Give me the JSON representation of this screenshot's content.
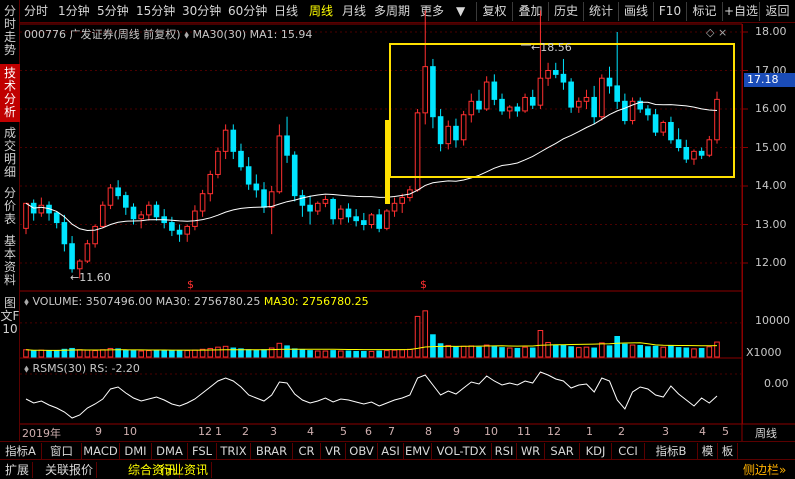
{
  "toolbar": {
    "periods": [
      "分时",
      "1分钟",
      "5分钟",
      "15分钟",
      "30分钟",
      "60分钟",
      "日线",
      "周线",
      "月线",
      "多周期",
      "更多"
    ],
    "active_period": "周线",
    "buttons": [
      "复权",
      "叠加",
      "历史",
      "统计",
      "画线",
      "F10",
      "标记",
      "+自选",
      "返回"
    ]
  },
  "left_tabs": [
    "分时走势",
    "技术分析",
    "成交明细",
    "分价表",
    "基本资料",
    "图文F10"
  ],
  "active_left_tab": "技术分析",
  "main_chart": {
    "stock_title": "000776 广发证券(周线 前复权)",
    "ma_label": "MA30(30)",
    "ma_value": "MA1: 15.94",
    "current_price": "17.18",
    "high_marker": "18.56",
    "low_marker": "11.60",
    "y_ticks": [
      "18.00",
      "17.00",
      "16.00",
      "15.00",
      "14.00",
      "13.00",
      "12.00"
    ],
    "dividend_marks": [
      "$",
      "$"
    ]
  },
  "volume_pane": {
    "title": "VOLUME: 3507496.00",
    "ma_label": "MA30: 2756780.25",
    "ma_label_2": "MA30: 2756780.25",
    "y_tick": "10000",
    "unit": "X1000"
  },
  "rsms_pane": {
    "title": "RSMS(30)",
    "value": "RS: -2.20",
    "y_tick": "0.00"
  },
  "date_axis": {
    "labels": [
      "2019年",
      "9",
      "10",
      "12",
      "1",
      "2",
      "3",
      "4",
      "5",
      "6",
      "7",
      "8",
      "9",
      "10",
      "11",
      "12",
      "1",
      "2",
      "3",
      "4",
      "5"
    ],
    "right_label": "周线"
  },
  "indicator_tabs": [
    "指标A",
    "窗口",
    "MACD",
    "DMI",
    "DMA",
    "FSL",
    "TRIX",
    "BRAR",
    "CR",
    "VR",
    "OBV",
    "ASI",
    "EMV",
    "VOL-TDX",
    "RSI",
    "WR",
    "SAR",
    "KDJ",
    "CCI",
    "指标B",
    "模",
    "板"
  ],
  "info_bar": {
    "items": [
      "扩展",
      "关联报价",
      "综合资讯",
      "行业资讯"
    ],
    "right": "侧边栏"
  },
  "colors": {
    "up": "#ff3030",
    "down": "#00e5ff",
    "ma_line": "#ffffff",
    "highlight_box": "#ffe000",
    "frame": "#8b0000",
    "accent_yellow": "#ffff00"
  },
  "candles": [
    [
      12.9,
      13.55,
      12.75,
      13.55
    ],
    [
      13.55,
      13.65,
      13.1,
      13.3
    ],
    [
      13.3,
      13.7,
      13.2,
      13.5
    ],
    [
      13.5,
      13.6,
      13.1,
      13.3
    ],
    [
      13.3,
      13.35,
      12.9,
      13.05
    ],
    [
      13.05,
      13.25,
      12.3,
      12.5
    ],
    [
      12.5,
      12.7,
      11.75,
      11.85
    ],
    [
      11.85,
      12.1,
      11.6,
      12.05
    ],
    [
      12.05,
      12.6,
      12.0,
      12.5
    ],
    [
      12.5,
      13.0,
      12.4,
      12.95
    ],
    [
      12.95,
      13.6,
      12.9,
      13.5
    ],
    [
      13.5,
      14.05,
      13.4,
      13.95
    ],
    [
      13.95,
      14.15,
      13.65,
      13.75
    ],
    [
      13.75,
      13.85,
      13.25,
      13.45
    ],
    [
      13.45,
      13.55,
      13.0,
      13.15
    ],
    [
      13.15,
      13.35,
      12.9,
      13.25
    ],
    [
      13.25,
      13.6,
      13.1,
      13.5
    ],
    [
      13.5,
      13.6,
      13.1,
      13.2
    ],
    [
      13.2,
      13.4,
      12.9,
      13.05
    ],
    [
      13.05,
      13.2,
      12.7,
      12.85
    ],
    [
      12.85,
      13.0,
      12.55,
      12.75
    ],
    [
      12.75,
      13.0,
      12.55,
      12.95
    ],
    [
      12.95,
      13.5,
      12.85,
      13.35
    ],
    [
      13.35,
      13.9,
      13.2,
      13.8
    ],
    [
      13.8,
      14.4,
      13.6,
      14.3
    ],
    [
      14.3,
      15.0,
      14.2,
      14.9
    ],
    [
      14.9,
      15.6,
      14.7,
      15.45
    ],
    [
      15.45,
      15.6,
      14.7,
      14.9
    ],
    [
      14.9,
      15.1,
      14.4,
      14.5
    ],
    [
      14.5,
      14.75,
      13.9,
      14.05
    ],
    [
      14.05,
      14.3,
      13.7,
      13.9
    ],
    [
      13.9,
      14.1,
      13.3,
      13.45
    ],
    [
      13.45,
      14.0,
      12.75,
      13.85
    ],
    [
      13.85,
      15.6,
      13.8,
      15.3
    ],
    [
      15.3,
      15.8,
      14.6,
      14.8
    ],
    [
      14.8,
      14.9,
      13.6,
      13.75
    ],
    [
      13.75,
      13.9,
      13.2,
      13.5
    ],
    [
      13.5,
      13.75,
      13.0,
      13.35
    ],
    [
      13.35,
      13.6,
      13.25,
      13.55
    ],
    [
      13.55,
      13.75,
      13.45,
      13.65
    ],
    [
      13.65,
      13.7,
      13.0,
      13.15
    ],
    [
      13.15,
      13.5,
      13.0,
      13.4
    ],
    [
      13.4,
      13.55,
      13.05,
      13.2
    ],
    [
      13.2,
      13.4,
      12.95,
      13.1
    ],
    [
      13.1,
      13.3,
      12.85,
      13.0
    ],
    [
      13.0,
      13.3,
      12.9,
      13.25
    ],
    [
      13.25,
      13.4,
      12.8,
      12.9
    ],
    [
      12.9,
      13.4,
      12.85,
      13.35
    ],
    [
      13.35,
      13.7,
      13.2,
      13.55
    ],
    [
      13.55,
      13.8,
      13.3,
      13.7
    ],
    [
      13.7,
      14.0,
      13.6,
      13.9
    ],
    [
      13.9,
      16.0,
      13.85,
      15.9
    ],
    [
      15.9,
      18.56,
      15.6,
      17.1
    ],
    [
      17.1,
      17.3,
      15.5,
      15.8
    ],
    [
      15.8,
      16.0,
      14.9,
      15.1
    ],
    [
      15.1,
      15.7,
      14.95,
      15.55
    ],
    [
      15.55,
      15.75,
      15.0,
      15.2
    ],
    [
      15.2,
      15.95,
      15.05,
      15.85
    ],
    [
      15.85,
      16.4,
      15.65,
      16.2
    ],
    [
      16.2,
      16.5,
      15.9,
      16.0
    ],
    [
      16.0,
      16.85,
      15.95,
      16.7
    ],
    [
      16.7,
      16.9,
      16.1,
      16.25
    ],
    [
      16.25,
      16.4,
      15.85,
      15.95
    ],
    [
      15.95,
      16.1,
      15.75,
      16.05
    ],
    [
      16.05,
      16.15,
      15.8,
      15.95
    ],
    [
      15.95,
      16.4,
      15.9,
      16.3
    ],
    [
      16.3,
      16.5,
      16.0,
      16.1
    ],
    [
      16.1,
      18.56,
      16.0,
      16.8
    ],
    [
      16.8,
      17.2,
      16.6,
      17.0
    ],
    [
      17.0,
      17.2,
      16.8,
      16.9
    ],
    [
      16.9,
      17.3,
      16.5,
      16.7
    ],
    [
      16.7,
      16.8,
      15.9,
      16.05
    ],
    [
      16.05,
      16.3,
      15.9,
      16.2
    ],
    [
      16.2,
      16.5,
      16.0,
      16.3
    ],
    [
      16.3,
      16.6,
      15.6,
      15.8
    ],
    [
      15.8,
      16.9,
      15.7,
      16.8
    ],
    [
      16.8,
      17.1,
      16.4,
      16.6
    ],
    [
      16.6,
      18.0,
      16.0,
      16.2
    ],
    [
      16.2,
      16.4,
      15.6,
      15.7
    ],
    [
      15.7,
      16.3,
      15.6,
      16.2
    ],
    [
      16.2,
      16.3,
      15.9,
      16.0
    ],
    [
      16.0,
      16.1,
      15.7,
      15.85
    ],
    [
      15.85,
      16.0,
      15.3,
      15.4
    ],
    [
      15.4,
      15.7,
      15.3,
      15.65
    ],
    [
      15.65,
      15.8,
      15.1,
      15.2
    ],
    [
      15.2,
      15.5,
      14.9,
      15.0
    ],
    [
      15.0,
      15.2,
      14.6,
      14.7
    ],
    [
      14.7,
      14.95,
      14.55,
      14.9
    ],
    [
      14.9,
      15.0,
      14.7,
      14.8
    ],
    [
      14.8,
      15.3,
      14.75,
      15.2
    ],
    [
      15.2,
      16.45,
      15.1,
      16.25
    ]
  ],
  "volumes": [
    1.7,
    1.5,
    1.6,
    1.4,
    1.5,
    1.8,
    2.0,
    1.7,
    1.6,
    1.5,
    1.7,
    2.0,
    1.9,
    1.6,
    1.5,
    1.4,
    1.5,
    1.6,
    1.5,
    1.4,
    1.4,
    1.5,
    1.6,
    1.8,
    2.0,
    2.3,
    2.5,
    2.1,
    1.9,
    1.7,
    1.6,
    1.7,
    2.1,
    3.2,
    2.6,
    1.9,
    1.7,
    1.5,
    1.4,
    1.4,
    1.5,
    1.4,
    1.4,
    1.3,
    1.3,
    1.3,
    1.4,
    1.5,
    1.6,
    1.7,
    1.8,
    9.5,
    10.8,
    5.2,
    3.1,
    2.7,
    2.3,
    2.5,
    2.6,
    2.3,
    2.8,
    2.4,
    2.2,
    2.1,
    2.0,
    2.3,
    2.1,
    6.2,
    3.4,
    2.8,
    2.7,
    2.4,
    2.2,
    2.3,
    2.1,
    3.3,
    2.6,
    4.8,
    3.0,
    2.8,
    2.7,
    2.4,
    2.5,
    2.3,
    2.6,
    2.2,
    2.1,
    1.9,
    2.0,
    2.4,
    3.5
  ],
  "rsms": [
    -2.5,
    -2.9,
    -2.7,
    -3.1,
    -3.4,
    -3.8,
    -4.4,
    -4.1,
    -3.4,
    -3.0,
    -2.5,
    -1.5,
    -1.3,
    -1.9,
    -2.4,
    -2.7,
    -2.5,
    -2.3,
    -2.6,
    -3.0,
    -3.2,
    -2.9,
    -2.5,
    -1.9,
    -1.3,
    -0.7,
    -0.4,
    -0.7,
    -1.3,
    -2.1,
    -2.4,
    -2.7,
    -2.1,
    -0.8,
    -0.9,
    -2.0,
    -2.6,
    -2.9,
    -2.7,
    -2.4,
    -2.8,
    -2.5,
    -2.6,
    -2.8,
    -3.0,
    -2.8,
    -3.2,
    -2.9,
    -2.6,
    -2.4,
    -2.1,
    -0.4,
    -0.1,
    -1.1,
    -2.1,
    -1.7,
    -2.0,
    -1.4,
    -0.8,
    -1.0,
    -0.2,
    -0.7,
    -1.1,
    -0.9,
    -1.1,
    -0.7,
    -0.9,
    0.2,
    -0.1,
    -0.5,
    -0.7,
    -1.4,
    -1.1,
    -1.0,
    -1.8,
    -0.4,
    -0.7,
    -2.6,
    -3.5,
    -1.8,
    -1.3,
    -1.5,
    -2.1,
    -2.3,
    -1.2,
    -2.0,
    -2.6,
    -3.2,
    -2.4,
    -2.9,
    -2.2
  ]
}
